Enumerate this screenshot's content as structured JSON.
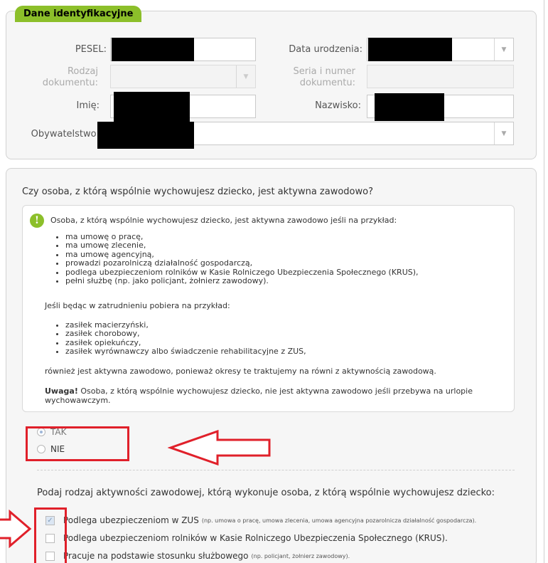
{
  "section1": {
    "title": "Dane identyfikacyjne",
    "pesel_label": "PESEL:",
    "dob_label": "Data urodzenia:",
    "doctype_label_1": "Rodzaj",
    "doctype_label_2": "dokumentu:",
    "series_label_1": "Seria i numer",
    "series_label_2": "dokumentu:",
    "firstname_label": "Imię:",
    "lastname_label": "Nazwisko:",
    "citizenship_label": "Obywatelstwo:",
    "dropdown_arrow": "▼"
  },
  "section2": {
    "question": "Czy osoba, z którą wspólnie wychowujesz dziecko, jest aktywna zawodowo?",
    "info": {
      "icon": "!",
      "intro": "Osoba, z którą wspólnie wychowujesz dziecko, jest aktywna zawodowo jeśli na przykład:",
      "list1": [
        "ma umowę o pracę,",
        "ma umowę zlecenie,",
        "ma umowę agencyjną,",
        "prowadzi pozarolniczą działalność gospodarczą,",
        "podlega ubezpieczeniom rolników w Kasie Rolniczego Ubezpieczenia Społecznego (KRUS),",
        "pełni służbę (np. jako policjant, żołnierz zawodowy)."
      ],
      "para2": "Jeśli będąc w zatrudnieniu pobiera na przykład:",
      "list2": [
        "zasiłek macierzyński,",
        "zasiłek chorobowy,",
        "zasiłek opiekuńczy,",
        "zasiłek wyrównawczy albo świadczenie rehabilitacyjne z ZUS,"
      ],
      "para3": "również jest aktywna zawodowo, ponieważ okresy te traktujemy na równi z aktywnością zawodową.",
      "warning_bold": "Uwaga!",
      "warning_text": " Osoba, z którą wspólnie wychowujesz dziecko, nie jest aktywna zawodowo jeśli przebywa na urlopie wychowawczym."
    },
    "radio_tak": "TAK",
    "radio_nie": "NIE",
    "question2": "Podaj rodzaj aktywności zawodowej, którą wykonuje osoba, z którą wspólnie wychowujesz dziecko:",
    "checkboxes": [
      {
        "label": "Podlega ubezpieczeniom w ZUS",
        "note": "(np. umowa o pracę, umowa zlecenia, umowa agencyjna pozarolnicza działalność gospodarcza).",
        "checked": true
      },
      {
        "label": "Podlega ubezpieczeniom rolników w Kasie Rolniczego Ubezpieczenia Społecznego (KRUS).",
        "note": "",
        "checked": false
      },
      {
        "label": "Pracuje na podstawie stosunku służbowego",
        "note": "(np. policjant, żołnierz zawodowy).",
        "checked": false
      }
    ],
    "check_mark": "✓"
  },
  "colors": {
    "accent_green": "#8cbf2a",
    "annotation_red": "#e0202a"
  }
}
